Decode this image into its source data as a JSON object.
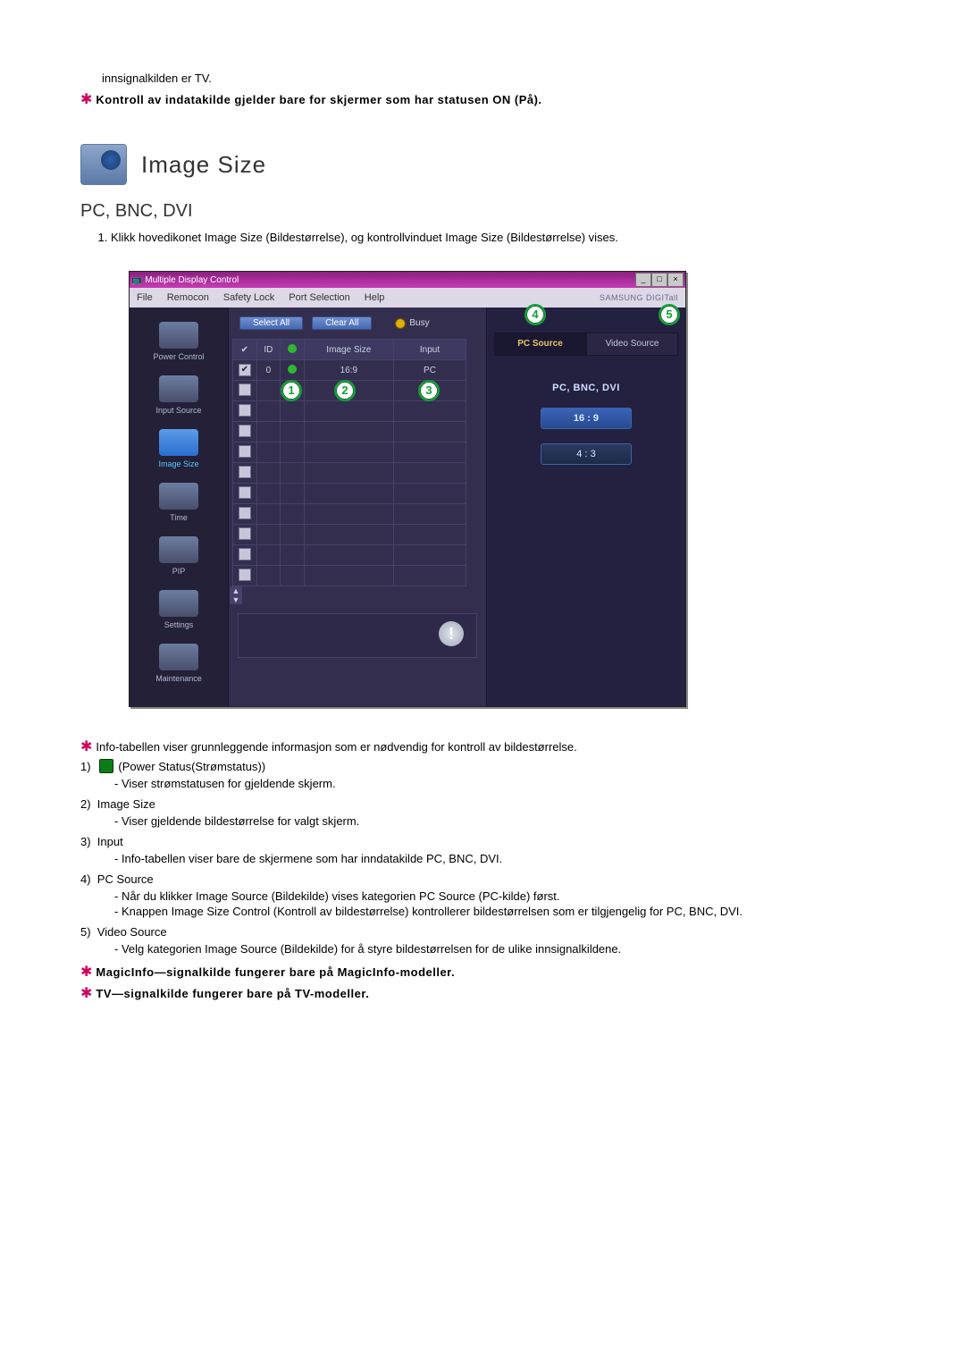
{
  "intro": {
    "line1": "innsignalkilden er TV.",
    "line2": "Kontroll av indatakilde gjelder bare for skjermer som har statusen ON (På)."
  },
  "heading": "Image Size",
  "subheading": "PC, BNC, DVI",
  "step1": "Klikk hovedikonet Image Size (Bildestørrelse), og kontrollvinduet Image Size (Bildestørrelse) vises.",
  "window": {
    "title": "Multiple Display Control",
    "menu": [
      "File",
      "Remocon",
      "Safety Lock",
      "Port Selection",
      "Help"
    ],
    "brand": "SAMSUNG DIGITall",
    "sidebar": [
      {
        "label": "Power Control",
        "selected": false
      },
      {
        "label": "Input Source",
        "selected": false
      },
      {
        "label": "Image Size",
        "selected": true
      },
      {
        "label": "Time",
        "selected": false
      },
      {
        "label": "PIP",
        "selected": false
      },
      {
        "label": "Settings",
        "selected": false
      },
      {
        "label": "Maintenance",
        "selected": false
      }
    ],
    "select_all": "Select All",
    "clear_all": "Clear All",
    "busy": "Busy",
    "grid_head": {
      "check": "✔",
      "id": "ID",
      "power": "",
      "size": "Image Size",
      "input": "Input"
    },
    "row0": {
      "id": "0",
      "size": "16:9",
      "input": "PC"
    },
    "tabs": {
      "pc": "PC Source",
      "video": "Video Source"
    },
    "section": "PC, BNC, DVI",
    "opt169": "16 : 9",
    "opt43": "4 : 3"
  },
  "explain": {
    "star1": "Info-tabellen viser grunnleggende informasjon som er nødvendig for kontroll av bildestørrelse.",
    "l1a": "(Power Status(Strømstatus))",
    "l1b": "- Viser strømstatusen for gjeldende skjerm.",
    "l2a": "Image Size",
    "l2b": "- Viser gjeldende bildestørrelse for valgt skjerm.",
    "l3a": "Input",
    "l3b": "- Info-tabellen viser bare de skjermene som har inndatakilde PC, BNC, DVI.",
    "l4a": "PC Source",
    "l4b": "- Når du klikker Image Source (Bildekilde) vises kategorien PC Source (PC-kilde) først.",
    "l4c": "- Knappen Image Size Control (Kontroll av bildestørrelse) kontrollerer bildestørrelsen som er tilgjengelig for PC, BNC, DVI.",
    "l5a": "Video Source",
    "l5b": "- Velg kategorien Image Source (Bildekilde) for å styre bildestørrelsen for de ulike innsignalkildene.",
    "star2": "MagicInfo—signalkilde fungerer bare på MagicInfo-modeller.",
    "star3": "TV—signalkilde fungerer bare på TV-modeller."
  }
}
